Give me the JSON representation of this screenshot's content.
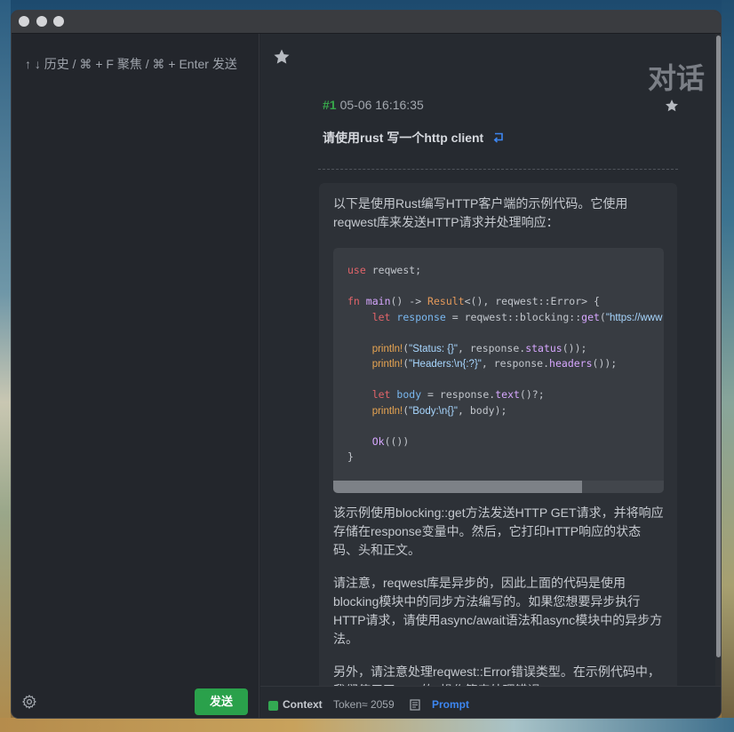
{
  "window": {
    "title": ""
  },
  "sidebar": {
    "hint": "↑ ↓ 历史 / ⌘ + F 聚焦 / ⌘ + Enter 发送",
    "send_label": "发送",
    "settings_icon": "gear-icon"
  },
  "main": {
    "title": "对话",
    "message": {
      "number": "#1",
      "timestamp": "05-06 16:16:35",
      "prompt": "请使用rust 写一个http client"
    },
    "answer": {
      "intro": "以下是使用Rust编写HTTP客户端的示例代码。它使用reqwest库来发送HTTP请求并处理响应：",
      "code_lines": [
        "use reqwest;",
        "",
        "fn main() -> Result<(), reqwest::Error> {",
        "    let response = reqwest::blocking::get(\"https://www",
        "",
        "    println!(\"Status: {}\", response.status());",
        "    println!(\"Headers:\\n{:?}\", response.headers());",
        "",
        "    let body = response.text()?;",
        "    println!(\"Body:\\n{}\", body);",
        "",
        "    Ok(())",
        "}"
      ],
      "para2": "该示例使用blocking::get方法发送HTTP GET请求，并将响应存储在response变量中。然后，它打印HTTP响应的状态码、头和正文。",
      "para3": "请注意，reqwest库是异步的，因此上面的代码是使用blocking模块中的同步方法编写的。如果您想要异步执行HTTP请求，请使用async/await语法和async模块中的异步方法。",
      "para4": "另外，请注意处理reqwest::Error错误类型。在示例代码中，我们使用了Rust的?操作符来处理错误。"
    }
  },
  "statusbar": {
    "context_label": "Context",
    "token_text": "Token≈ 2059",
    "prompt_label": "Prompt"
  },
  "colors": {
    "accent_green": "#2aa14b",
    "link_blue": "#3d86f0",
    "background": "#24272d"
  }
}
